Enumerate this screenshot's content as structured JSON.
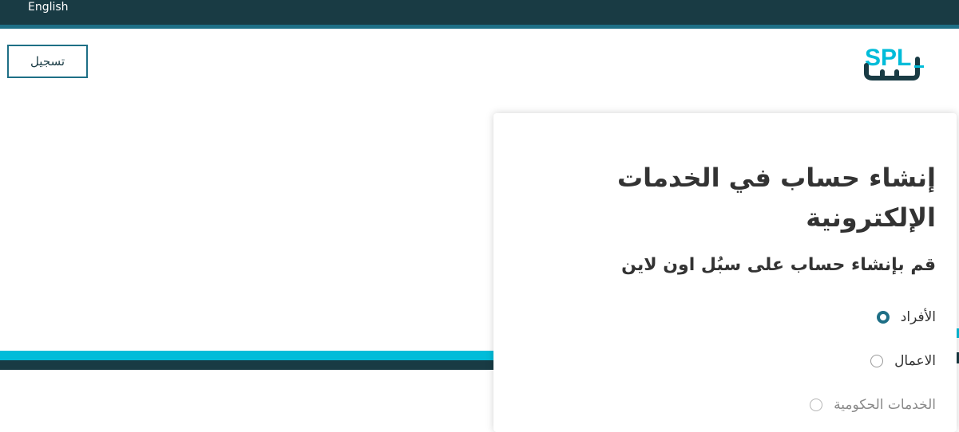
{
  "header": {
    "language_link": "English",
    "register_button": "تسجيل",
    "logo_alt": "سبل SPL"
  },
  "signup_card": {
    "title": "إنشاء حساب في الخدمات الإلكترونية",
    "subtitle": "قم بإنشاء حساب على سبُل اون لاين",
    "account_types": [
      {
        "label": "الأفراد",
        "selected": true,
        "enabled": true
      },
      {
        "label": "الاعمال",
        "selected": false,
        "enabled": true
      },
      {
        "label": "الخدمات الحكومية",
        "selected": false,
        "enabled": false
      }
    ]
  },
  "colors": {
    "header_dark": "#193b44",
    "accent_teal": "#1e6f86",
    "accent_cyan": "#00bcd9"
  }
}
